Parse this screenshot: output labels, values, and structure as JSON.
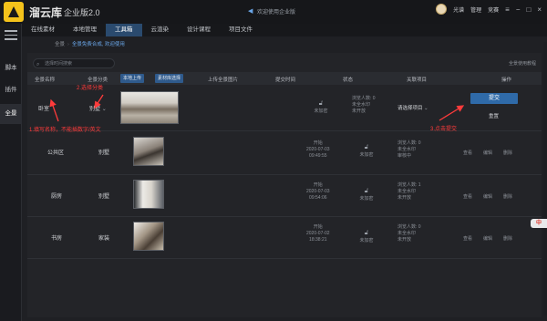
{
  "app": {
    "title": "溜云库",
    "subtitle": "企业版2.0",
    "welcome": "欢迎使用企业版",
    "user": {
      "name": "光谱",
      "menu": [
        "管理",
        "竞赛"
      ],
      "menu_icon": "hamburger-icon"
    },
    "window_controls": [
      "−",
      "□",
      "×"
    ]
  },
  "rail": {
    "items": [
      "脚本",
      "插件",
      "全景"
    ],
    "active": "全景"
  },
  "nav": {
    "tabs": [
      "在线素材",
      "本地管理",
      "工具箱",
      "云渲染",
      "设计课程",
      "项目文件"
    ],
    "active": "工具箱"
  },
  "breadcrumb": [
    "全景",
    "全景免费合成, 欢迎使用"
  ],
  "search": {
    "placeholder": "选择时间搜索"
  },
  "usage_link": "全景使用教程",
  "table": {
    "headers": {
      "name": "全景名称",
      "category": "全景分类",
      "upload_local": "本地上传",
      "choose_material": "素材库选择",
      "upload_image": "上传全景图片",
      "submit_time": "提交时间",
      "status": "状态",
      "project": "关联项目",
      "operation": "操作"
    },
    "new_row": {
      "name": "卧室",
      "category": "别墅",
      "lock_label": "未加密",
      "stats": [
        "浏览人数: 0",
        "未全水印",
        "未开放"
      ],
      "project_select": "请选择项目",
      "submit": "提交",
      "reset": "重置"
    },
    "rows": [
      {
        "name": "公共区",
        "category": "别墅",
        "time_label": "开始",
        "date": "2020-07-03",
        "time": "09:49:55",
        "lock_label": "未加密",
        "stats": [
          "浏览人数: 0",
          "未全水印",
          "审核中"
        ],
        "ops": [
          "查看",
          "编辑",
          "删除"
        ]
      },
      {
        "name": "厨房",
        "category": "别墅",
        "time_label": "开始",
        "date": "2020-07-03",
        "time": "09:54:06",
        "lock_label": "未加密",
        "stats": [
          "浏览人数: 1",
          "未全水印",
          "未开放"
        ],
        "ops": [
          "查看",
          "编辑",
          "删除"
        ]
      },
      {
        "name": "书房",
        "category": "家装",
        "time_label": "开始",
        "date": "2020-07-02",
        "time": "18:38:21",
        "lock_label": "未加密",
        "stats": [
          "浏览人数: 0",
          "未全水印",
          "未开放"
        ],
        "ops": [
          "查看",
          "编辑",
          "删除"
        ]
      }
    ]
  },
  "annotations": {
    "step1": "1.填写名称，不能插数字/英文",
    "step2": "2.选择分类",
    "step3": "3.点击提交"
  },
  "float_badge": "中",
  "colors": {
    "accent": "#2f6aa8",
    "annotation": "#ff3b3b",
    "active_tab": "#2a4a6e"
  }
}
